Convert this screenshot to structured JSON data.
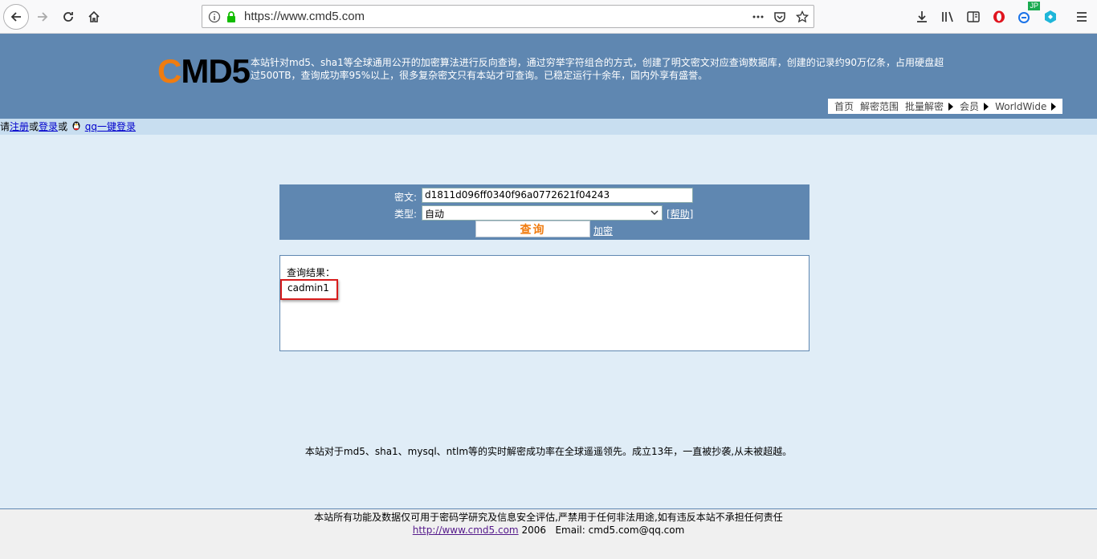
{
  "browser": {
    "url": "https://www.cmd5.com",
    "extension_badge": "JP"
  },
  "header": {
    "logo_first": "C",
    "logo_rest": "MD5",
    "intro": "本站针对md5、sha1等全球通用公开的加密算法进行反向查询，通过穷举字符组合的方式，创建了明文密文对应查询数据库，创建的记录约90万亿条，占用硬盘超过500TB，查询成功率95%以上，很多复杂密文只有本站才可查询。已稳定运行十余年，国内外享有盛誉。",
    "nav": [
      "首页",
      "解密范围",
      "批量解密",
      "会员",
      "WorldWide"
    ]
  },
  "login": {
    "prefix": "请",
    "register": "注册",
    "or1": "或",
    "login": "登录",
    "or2": "或",
    "qq_login": "qq一键登录"
  },
  "form": {
    "cipher_label": "密文:",
    "cipher_value": "d1811d096ff0340f96a0772621f04243",
    "type_label": "类型:",
    "type_value": "自动",
    "help": "[帮助]",
    "query_button": "查询",
    "encrypt": "加密"
  },
  "result": {
    "label": "查询结果：",
    "value": "cadmin1"
  },
  "claim": "本站对于md5、sha1、mysql、ntlm等的实时解密成功率在全球遥遥领先。成立13年，一直被抄袭,从未被超越。",
  "footer": {
    "disclaimer": "本站所有功能及数据仅可用于密码学研究及信息安全评估,严禁用于任何非法用途,如有违反本站不承担任何责任",
    "site_link": "http://www.cmd5.com",
    "year": "2006",
    "email": "Email: cmd5.com@qq.com"
  },
  "colors": {
    "header_bg": "#5f87b1",
    "logo_accent": "#f07c10",
    "highlight_border": "#d81c1c"
  }
}
